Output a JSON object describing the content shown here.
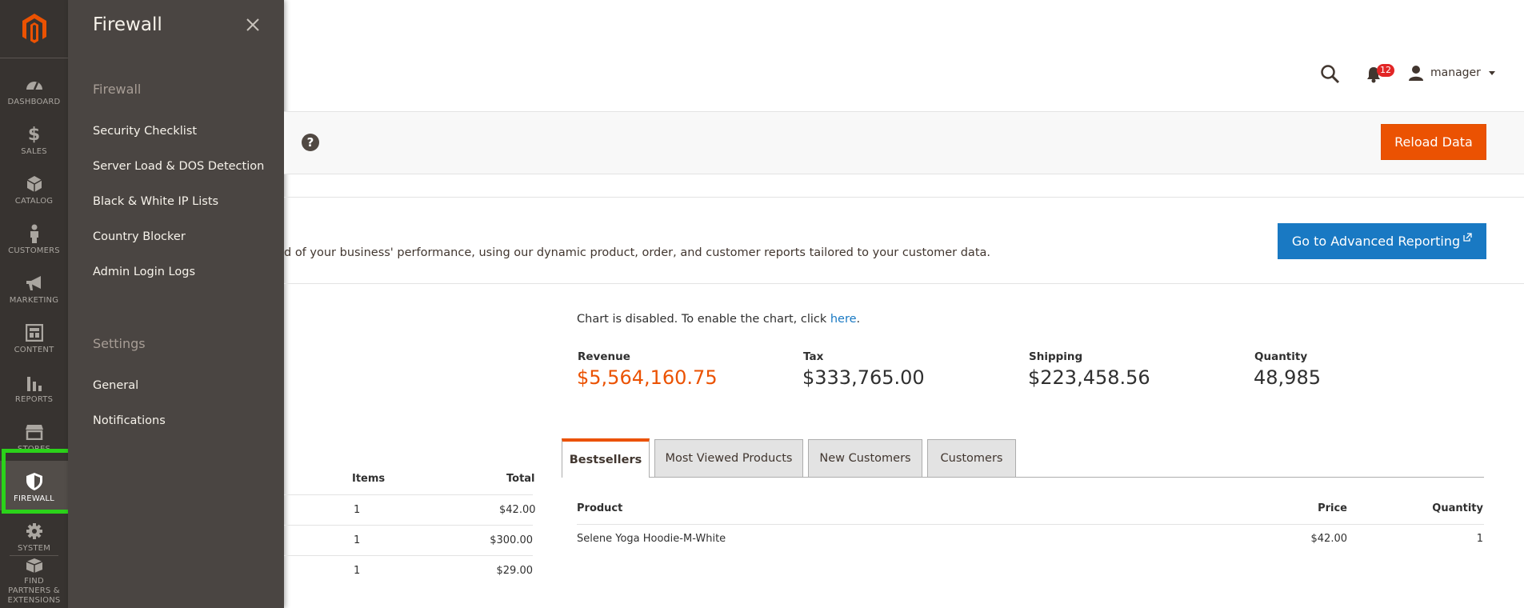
{
  "nav": {
    "items": [
      {
        "label": "DASHBOARD",
        "icon": "dashboard-icon"
      },
      {
        "label": "SALES",
        "icon": "dollar-icon"
      },
      {
        "label": "CATALOG",
        "icon": "cube-icon"
      },
      {
        "label": "CUSTOMERS",
        "icon": "person-icon"
      },
      {
        "label": "MARKETING",
        "icon": "megaphone-icon"
      },
      {
        "label": "CONTENT",
        "icon": "layout-icon"
      },
      {
        "label": "REPORTS",
        "icon": "bar-chart-icon"
      },
      {
        "label": "STORES",
        "icon": "storefront-icon"
      },
      {
        "label": "FIREWALL",
        "icon": "shield-icon"
      },
      {
        "label": "SYSTEM",
        "icon": "gear-icon"
      },
      {
        "label": "FIND PARTNERS & EXTENSIONS",
        "icon": "extensions-icon"
      }
    ],
    "active": "FIREWALL",
    "highlight_color": "#2bd21a"
  },
  "flyout": {
    "title": "Firewall",
    "sections": [
      {
        "heading": "Firewall",
        "links": [
          "Security Checklist",
          "Server Load & DOS Detection",
          "Black & White IP Lists",
          "Country Blocker",
          "Admin Login Logs"
        ]
      },
      {
        "heading": "Settings",
        "links": [
          "General",
          "Notifications"
        ]
      }
    ]
  },
  "header": {
    "notification_count": "12",
    "user": "manager"
  },
  "actions": {
    "help_glyph": "?",
    "reload_label": "Reload Data"
  },
  "advanced": {
    "text": "d of your business' performance, using our dynamic product, order, and customer reports tailored to your customer data.",
    "button_label": "Go to Advanced Reporting"
  },
  "chart_note": {
    "text": "Chart is disabled. To enable the chart, click ",
    "link": "here",
    "suffix": "."
  },
  "totals": [
    {
      "label": "Revenue",
      "value": "$5,564,160.75"
    },
    {
      "label": "Tax",
      "value": "$333,765.00"
    },
    {
      "label": "Shipping",
      "value": "$223,458.56"
    },
    {
      "label": "Quantity",
      "value": "48,985"
    }
  ],
  "orders": {
    "columns": [
      "Items",
      "Total"
    ],
    "rows": [
      {
        "items": "1",
        "total": "$42.00"
      },
      {
        "items": "1",
        "total": "$300.00"
      },
      {
        "items": "1",
        "total": "$29.00"
      }
    ]
  },
  "tabs": [
    "Bestsellers",
    "Most Viewed Products",
    "New Customers",
    "Customers"
  ],
  "bestsellers": {
    "columns": [
      "Product",
      "Price",
      "Quantity"
    ],
    "rows": [
      {
        "product": "Selene Yoga Hoodie-M-White",
        "price": "$42.00",
        "quantity": "1"
      }
    ]
  },
  "colors": {
    "accent": "#eb5202",
    "primary": "#1979c3",
    "nav_bg": "#373330",
    "flyout_bg": "#4a4542"
  }
}
